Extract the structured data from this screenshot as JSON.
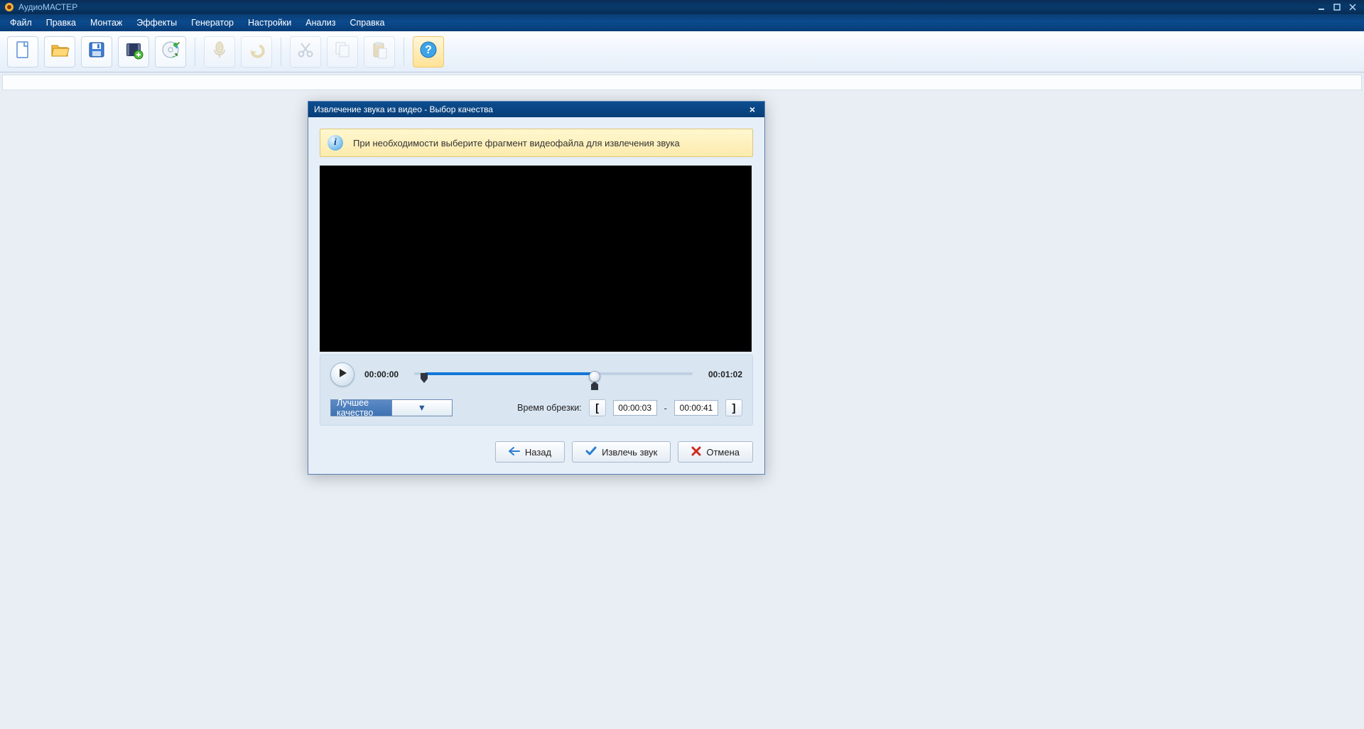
{
  "app_title": "АудиоМАСТЕР",
  "menu": {
    "file": "Файл",
    "edit": "Правка",
    "montage": "Монтаж",
    "effects": "Эффекты",
    "generator": "Генератор",
    "settings": "Настройки",
    "analysis": "Анализ",
    "help": "Справка"
  },
  "dialog": {
    "title": "Извлечение звука из видео - Выбор качества",
    "hint": "При необходимости выберите фрагмент видеофайла для извлечения звука",
    "time_start": "00:00:00",
    "time_end": "00:01:02",
    "quality": "Лучшее качество",
    "trim_label": "Время обрезки:",
    "trim_from": "00:00:03",
    "trim_to": "00:00:41",
    "dash": "-",
    "btn_back": "Назад",
    "btn_extract": "Извлечь звук",
    "btn_cancel": "Отмена"
  }
}
